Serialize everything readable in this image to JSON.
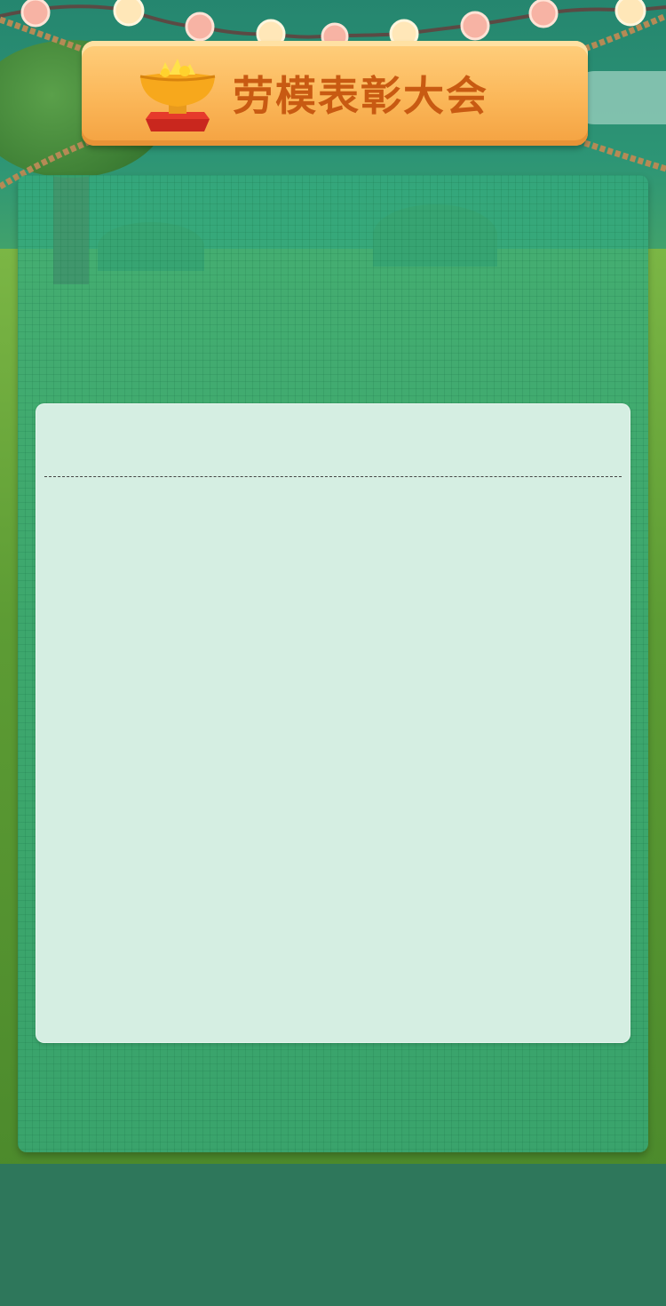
{
  "header": {
    "title": "劳模表彰大会"
  },
  "colors": {
    "banner": "#fbb759",
    "title_text": "#c85a12",
    "panel": "#34aa7d",
    "card": "#d5eee2",
    "bottom_ground": "#2e775b"
  },
  "icons": {
    "trophy": "trophy-icon"
  }
}
